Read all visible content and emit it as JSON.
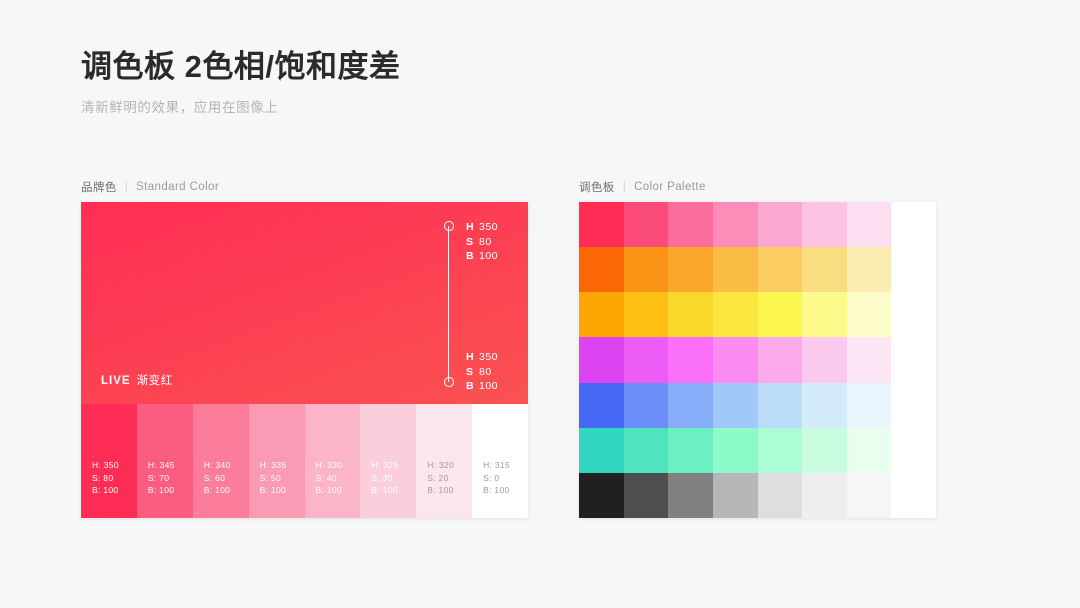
{
  "header": {
    "title": "调色板 2色相/饱和度差",
    "subtitle": "清新鲜明的效果，应用在图像上"
  },
  "sections": {
    "left": {
      "cn": "品牌色",
      "separator": "|",
      "en": "Standard Color"
    },
    "right": {
      "cn": "调色板",
      "separator": "|",
      "en": "Color Palette"
    }
  },
  "brand_color": {
    "gradient": {
      "from": "#FF2D55",
      "to": "#FA5251",
      "angle": "160deg"
    },
    "live_tag": {
      "live": "LIVE",
      "name": "渐变红"
    },
    "markers": [
      {
        "id": "top",
        "h_key": "H",
        "h": "350",
        "s_key": "S",
        "s": "80",
        "b_key": "B",
        "b": "100"
      },
      {
        "id": "bottom",
        "h_key": "H",
        "h": "350",
        "s_key": "S",
        "s": "80",
        "b_key": "B",
        "b": "100"
      }
    ],
    "swatches": [
      {
        "hex": "#FF2D55",
        "h": "H: 350",
        "s": "S: 80",
        "b": "B: 100",
        "text": "#ffffff"
      },
      {
        "hex": "#FB5D81",
        "h": "H: 345",
        "s": "S: 70",
        "b": "B: 100",
        "text": "#ffffff"
      },
      {
        "hex": "#FB7C9B",
        "h": "H: 340",
        "s": "S: 60",
        "b": "B: 100",
        "text": "#ffffff"
      },
      {
        "hex": "#FB9AB5",
        "h": "H: 335",
        "s": "S: 50",
        "b": "B: 100",
        "text": "#ffffff"
      },
      {
        "hex": "#FBB4C8",
        "h": "H: 330",
        "s": "S: 40",
        "b": "B: 100",
        "text": "#ffffff"
      },
      {
        "hex": "#FBCEDC",
        "h": "H: 325",
        "s": "S: 30",
        "b": "B: 100",
        "text": "#ffffff"
      },
      {
        "hex": "#FAE6EE",
        "h": "H: 320",
        "s": "S: 20",
        "b": "B: 100",
        "text": "#b9909f"
      },
      {
        "hex": "#FFFFFF",
        "h": "H: 315",
        "s": "S: 0",
        "b": "B: 100",
        "text": "#9a9a9a"
      }
    ]
  },
  "color_palette": {
    "rows": [
      {
        "name": "red-pink",
        "cells": [
          "#FF2D55",
          "#FB4C77",
          "#FB6E9C",
          "#FC8DB9",
          "#FBA8D0",
          "#FCC3E2",
          "#FBDFF0",
          "#FFFFFF"
        ]
      },
      {
        "name": "orange",
        "cells": [
          "#FB6606",
          "#FB9317",
          "#FBA72C",
          "#FBBC45",
          "#FBCC62",
          "#FBDD81",
          "#FBEDB2",
          "#FFFFFF"
        ]
      },
      {
        "name": "yellow",
        "cells": [
          "#FCA503",
          "#FCC013",
          "#FAD72B",
          "#FBE73D",
          "#FCF74F",
          "#FBFA8A",
          "#FCFCCB",
          "#FFFFFF"
        ]
      },
      {
        "name": "magenta",
        "cells": [
          "#DC44F2",
          "#ED5CF7",
          "#FA70FA",
          "#FC8CF2",
          "#FCAAEC",
          "#FBC9EE",
          "#FCE5F4",
          "#FFFFFF"
        ]
      },
      {
        "name": "blue",
        "cells": [
          "#4568F5",
          "#6B8DF7",
          "#87ACF8",
          "#A2C7F9",
          "#BCDCFA",
          "#D4EBFB",
          "#E9F6FD",
          "#FFFFFF"
        ]
      },
      {
        "name": "teal",
        "cells": [
          "#31D6C0",
          "#50E3C0",
          "#6CF0C2",
          "#8CFBC9",
          "#ACFCD4",
          "#C9FCDF",
          "#E8FEEF",
          "#FFFFFF"
        ]
      },
      {
        "name": "grayscale",
        "cells": [
          "#201F21",
          "#4E4D4F",
          "#818082",
          "#B7B6B8",
          "#DEDDDF",
          "#EEEDEF",
          "#F6F5F7",
          "#FFFFFF"
        ]
      }
    ]
  }
}
